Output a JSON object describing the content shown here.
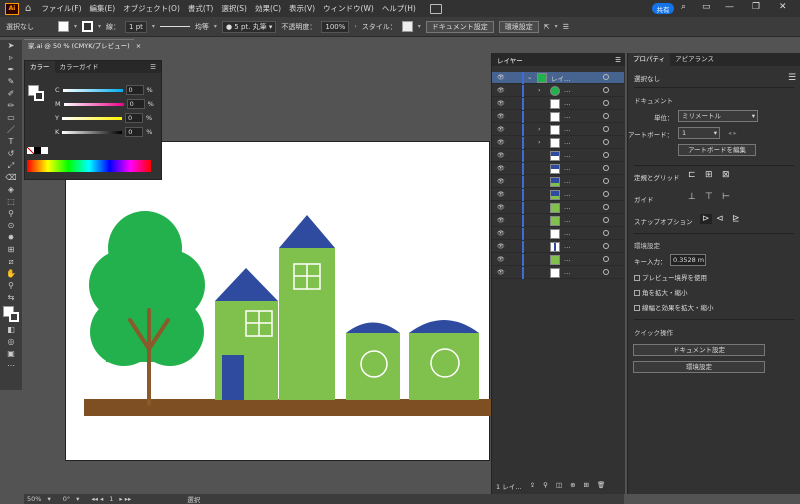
{
  "menubar": {
    "logo": "Ai",
    "items": [
      "ファイル(F)",
      "編集(E)",
      "オブジェクト(O)",
      "書式(T)",
      "選択(S)",
      "効果(C)",
      "表示(V)",
      "ウィンドウ(W)",
      "ヘルプ(H)"
    ],
    "share": "共有"
  },
  "control": {
    "selection": "選択なし",
    "stroke_label": "線：",
    "stroke_value": "1 pt",
    "uniform": "均等",
    "brush": "5 pt. 丸筆",
    "opacity_label": "不透明度：",
    "opacity_value": "100%",
    "style_label": "スタイル：",
    "doc_settings": "ドキュメント設定",
    "prefs": "環境設定"
  },
  "doc_tab": {
    "title": "家.ai @ 50 % (CMYK/プレビュー)",
    "close": "×"
  },
  "color_panel": {
    "tab1": "カラー",
    "tab2": "カラーガイド",
    "channels": [
      {
        "label": "C",
        "value": "0",
        "unit": "%"
      },
      {
        "label": "M",
        "value": "0",
        "unit": "%"
      },
      {
        "label": "Y",
        "value": "0",
        "unit": "%"
      },
      {
        "label": "K",
        "value": "0",
        "unit": "%"
      }
    ]
  },
  "layers_panel": {
    "title": "レイヤー",
    "top_layer": "レイ…",
    "item_label": "…",
    "footer": "1 レイ…"
  },
  "properties_panel": {
    "tab1": "プロパティ",
    "tab2": "アピアランス",
    "no_selection": "選択なし",
    "document": "ドキュメント",
    "unit_label": "単位：",
    "unit_value": "ミリメートル",
    "artboard_label": "アートボード：",
    "artboard_value": "1",
    "edit_artboard": "アートボードを編集",
    "rulers_grid": "定規とグリッド",
    "guides": "ガイド",
    "snap": "スナップオプション",
    "prefs_section": "環境設定",
    "key_label": "キー入力：",
    "key_value": "0.3528 m",
    "chk1": "プレビュー境界を使用",
    "chk2": "角を拡大・縮小",
    "chk3": "線幅と効果を拡大・縮小",
    "quick": "クイック操作",
    "doc_settings": "ドキュメント設定",
    "prefs": "環境設定"
  },
  "status": {
    "zoom": "50%",
    "angle": "0°",
    "artboard": "1",
    "mode": "選択"
  },
  "colors": {
    "tree": "#22b14c",
    "trunk": "#8a5a2b",
    "ground": "#7f4f24",
    "house": "#80c04d",
    "roof": "#2e4ba0",
    "accent": "#3f6cd4"
  }
}
